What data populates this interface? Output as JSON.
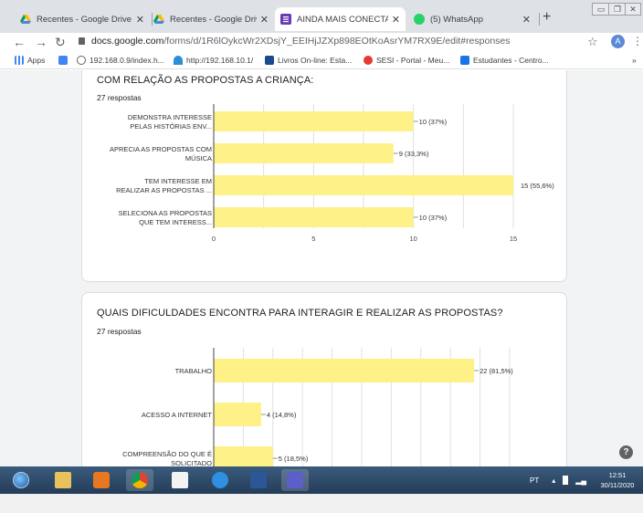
{
  "browser": {
    "tabs": [
      {
        "title": "Recentes - Google Drive",
        "icon": "google-drive-icon",
        "active": false
      },
      {
        "title": "Recentes - Google Drive",
        "icon": "google-drive-icon",
        "active": false
      },
      {
        "title": "AINDA MAIS CONECTADO",
        "icon": "google-forms-icon",
        "active": true
      },
      {
        "title": "(5) WhatsApp",
        "icon": "whatsapp-icon",
        "active": false
      }
    ],
    "new_tab": "+",
    "url_domain": "docs.google.com",
    "url_path": "/forms/d/1R6lOykcWr2XDsjY_EEIHjJZXp898EOtKoAsrYM7RX9E/edit#responses",
    "profile_initial": "A",
    "bookmarks": [
      {
        "label": "Apps",
        "icon": "apps-grid-icon"
      },
      {
        "label": "",
        "icon": "docs-icon"
      },
      {
        "label": "192.168.0.9/index.h...",
        "icon": "globe-icon"
      },
      {
        "label": "http://192.168.10.1/",
        "icon": "network-icon"
      },
      {
        "label": "Livros On-line: Esta...",
        "icon": "book-icon"
      },
      {
        "label": "SESI - Portal - Meu...",
        "icon": "sesi-icon"
      },
      {
        "label": "Estudantes - Centro...",
        "icon": "school-icon"
      }
    ],
    "bookmarks_overflow": "»"
  },
  "questions": [
    {
      "title": "COM RELAÇÃO AS PROPOSTAS A CRIANÇA:",
      "count": "27 respostas",
      "chart_data": {
        "type": "bar",
        "orientation": "horizontal",
        "categories": [
          [
            "DEMONSTRA INTERESSE",
            "PELAS HISTÓRIAS ENV..."
          ],
          [
            "APRECIA AS PROPOSTAS COM",
            "MÚSICA"
          ],
          [
            "TEM INTERESSE EM",
            "REALIZAR AS PROPOSTAS ..."
          ],
          [
            "SELECIONA AS PROPOSTAS",
            "QUE TEM INTERESS..."
          ]
        ],
        "values": [
          10,
          9,
          15,
          10
        ],
        "data_labels": [
          "10 (37%)",
          "9 (33,3%)",
          "15 (55,6%)",
          "10 (37%)"
        ],
        "xlim": [
          0,
          15
        ],
        "ticks": [
          0,
          5,
          10,
          15
        ],
        "color": "#fdf188"
      }
    },
    {
      "title": "QUAIS DIFICULDADES ENCONTRA PARA INTERAGIR E REALIZAR AS PROPOSTAS?",
      "count": "27 respostas",
      "chart_data": {
        "type": "bar",
        "orientation": "horizontal",
        "categories": [
          [
            "TRABALHO"
          ],
          [
            "ACESSO A INTERNET"
          ],
          [
            "COMPREENSÃO DO QUE É",
            "SOLICITADO"
          ]
        ],
        "values": [
          22,
          4,
          5
        ],
        "data_labels": [
          "22 (81,5%)",
          "4 (14,8%)",
          "5 (18,5%)"
        ],
        "xlim": [
          0,
          25
        ],
        "color": "#fdf188"
      }
    }
  ],
  "help": "?",
  "taskbar": {
    "apps": [
      "windows-start-icon",
      "file-explorer-icon",
      "media-player-icon",
      "chrome-icon",
      "calendar-icon",
      "internet-explorer-icon",
      "word-icon",
      "teams-icon"
    ],
    "language": "PT",
    "time": "12:51",
    "date": "30/11/2020"
  }
}
